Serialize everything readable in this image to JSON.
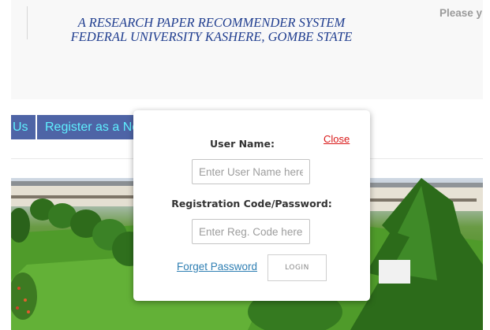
{
  "header": {
    "title_line1": "A RESEARCH PAPER RECOMMENDER SYSTEM",
    "title_line2": "FEDERAL UNIVERSITY KASHERE, GOMBE STATE",
    "login_hint": "Please y"
  },
  "nav": {
    "items": [
      {
        "label": "Us"
      },
      {
        "label": "Register as a Ne"
      }
    ]
  },
  "login_modal": {
    "close_label": "Close",
    "username_label": "User Name:",
    "username_placeholder": "Enter User Name here",
    "password_label": "Registration Code/Password:",
    "password_placeholder": "Enter Reg. Code here",
    "forgot_label": "Forget Password",
    "login_label": "LOGIN"
  },
  "colors": {
    "title": "#1f3d8f",
    "nav_bg": "#4e64a6",
    "nav_text": "#5ff0ff",
    "close": "#d91818",
    "link": "#2f7fb3"
  }
}
